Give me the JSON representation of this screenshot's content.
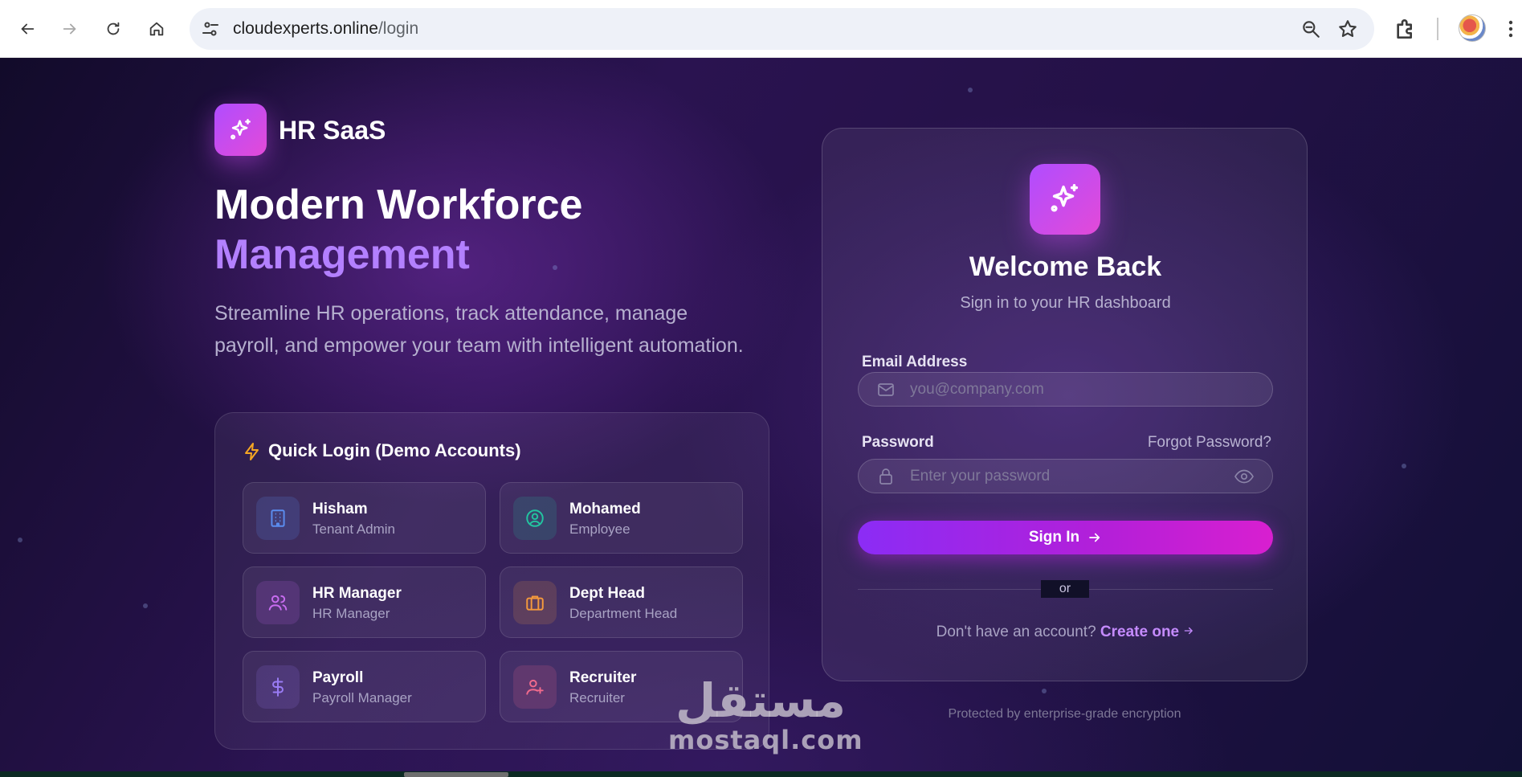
{
  "browser": {
    "url_domain": "cloudexperts.online",
    "url_path": "/login",
    "icons": [
      "back-icon",
      "forward-icon",
      "reload-icon",
      "home-icon",
      "site-settings-icon",
      "zoom-icon",
      "bookmark-star-icon",
      "extensions-icon",
      "profile-avatar",
      "more-icon"
    ]
  },
  "brand": {
    "name": "HR SaaS",
    "accent_gradient": [
      "#b04dff",
      "#e34ad8"
    ]
  },
  "hero": {
    "headline_line1": "Modern Workforce",
    "headline_line2": "Management",
    "headline_accent": "#b380ff",
    "subtitle_line1": "Streamline HR operations, track attendance, manage",
    "subtitle_line2": "payroll, and empower your team with intelligent automation."
  },
  "quick_login": {
    "title": "Quick Login (Demo Accounts)",
    "title_icon": "lightning-icon",
    "accounts": [
      {
        "name": "Hisham",
        "role": "Tenant Admin",
        "icon": "building-icon",
        "color": "#5b8def"
      },
      {
        "name": "Mohamed",
        "role": "Employee",
        "icon": "user-circle-icon",
        "color": "#22c5a0"
      },
      {
        "name": "HR Manager",
        "role": "HR Manager",
        "icon": "users-icon",
        "color": "#c86cf0"
      },
      {
        "name": "Dept Head",
        "role": "Department Head",
        "icon": "briefcase-icon",
        "color": "#f59a3c"
      },
      {
        "name": "Payroll",
        "role": "Payroll Manager",
        "icon": "dollar-icon",
        "color": "#9a7cf5"
      },
      {
        "name": "Recruiter",
        "role": "Recruiter",
        "icon": "user-plus-icon",
        "color": "#f06a8c"
      }
    ]
  },
  "login": {
    "title": "Welcome Back",
    "subtitle": "Sign in to your HR dashboard",
    "email_label": "Email Address",
    "email_placeholder": "you@company.com",
    "email_value": "",
    "password_label": "Password",
    "password_placeholder": "Enter your password",
    "password_value": "",
    "forgot_label": "Forgot Password?",
    "submit_label": "Sign In",
    "divider_text": "or",
    "signup_prompt": "Don't have an account?",
    "signup_link": "Create one",
    "footer_note": "Protected by enterprise-grade encryption"
  },
  "watermark": {
    "arabic": "مستقل",
    "latin": "mostaql.com"
  }
}
